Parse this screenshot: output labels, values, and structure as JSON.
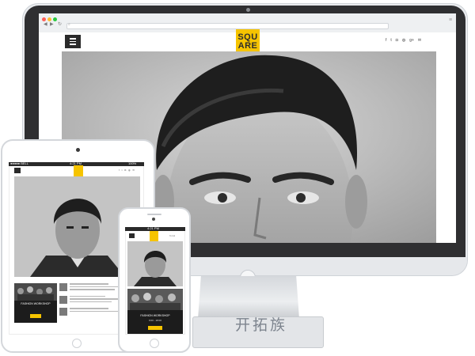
{
  "desktop": {
    "logo_top": "SQU",
    "logo_bottom": "ARE",
    "social_icons": [
      "facebook-icon",
      "twitter-icon",
      "instagram-icon",
      "pinterest-icon",
      "google-plus-icon",
      "mail-icon"
    ],
    "social_glyphs": [
      "f",
      "t",
      "◘",
      "◍",
      "g+",
      "✉"
    ],
    "browser_dots": [
      "#ff5f57",
      "#febc2e",
      "#28c840"
    ],
    "accent": "#f6c400"
  },
  "tablet": {
    "status_left": "●●●●● BELL",
    "status_time": "4:21 PM",
    "status_right": "100%",
    "event_title": "FASHION WORKSHOP"
  },
  "phone": {
    "status_time": "4:21 PM",
    "event_title": "FASHION WORKSHOP",
    "event_time": "9:00 - 18:00"
  },
  "watermark": "开拓族"
}
